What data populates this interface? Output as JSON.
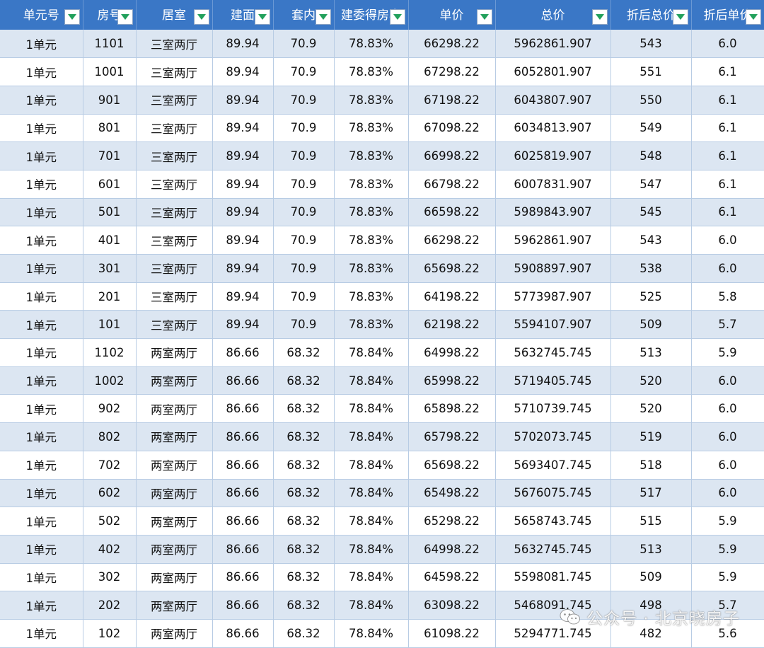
{
  "table": {
    "columns": [
      "单元号",
      "房号",
      "居室",
      "建面",
      "套内",
      "建委得房率",
      "单价",
      "总价",
      "折后总价",
      "折后单价"
    ],
    "rows": [
      [
        "1单元",
        "1101",
        "三室两厅",
        "89.94",
        "70.9",
        "78.83%",
        "66298.22",
        "5962861.907",
        "543",
        "6.0"
      ],
      [
        "1单元",
        "1001",
        "三室两厅",
        "89.94",
        "70.9",
        "78.83%",
        "67298.22",
        "6052801.907",
        "551",
        "6.1"
      ],
      [
        "1单元",
        "901",
        "三室两厅",
        "89.94",
        "70.9",
        "78.83%",
        "67198.22",
        "6043807.907",
        "550",
        "6.1"
      ],
      [
        "1单元",
        "801",
        "三室两厅",
        "89.94",
        "70.9",
        "78.83%",
        "67098.22",
        "6034813.907",
        "549",
        "6.1"
      ],
      [
        "1单元",
        "701",
        "三室两厅",
        "89.94",
        "70.9",
        "78.83%",
        "66998.22",
        "6025819.907",
        "548",
        "6.1"
      ],
      [
        "1单元",
        "601",
        "三室两厅",
        "89.94",
        "70.9",
        "78.83%",
        "66798.22",
        "6007831.907",
        "547",
        "6.1"
      ],
      [
        "1单元",
        "501",
        "三室两厅",
        "89.94",
        "70.9",
        "78.83%",
        "66598.22",
        "5989843.907",
        "545",
        "6.1"
      ],
      [
        "1单元",
        "401",
        "三室两厅",
        "89.94",
        "70.9",
        "78.83%",
        "66298.22",
        "5962861.907",
        "543",
        "6.0"
      ],
      [
        "1单元",
        "301",
        "三室两厅",
        "89.94",
        "70.9",
        "78.83%",
        "65698.22",
        "5908897.907",
        "538",
        "6.0"
      ],
      [
        "1单元",
        "201",
        "三室两厅",
        "89.94",
        "70.9",
        "78.83%",
        "64198.22",
        "5773987.907",
        "525",
        "5.8"
      ],
      [
        "1单元",
        "101",
        "三室两厅",
        "89.94",
        "70.9",
        "78.83%",
        "62198.22",
        "5594107.907",
        "509",
        "5.7"
      ],
      [
        "1单元",
        "1102",
        "两室两厅",
        "86.66",
        "68.32",
        "78.84%",
        "64998.22",
        "5632745.745",
        "513",
        "5.9"
      ],
      [
        "1单元",
        "1002",
        "两室两厅",
        "86.66",
        "68.32",
        "78.84%",
        "65998.22",
        "5719405.745",
        "520",
        "6.0"
      ],
      [
        "1单元",
        "902",
        "两室两厅",
        "86.66",
        "68.32",
        "78.84%",
        "65898.22",
        "5710739.745",
        "520",
        "6.0"
      ],
      [
        "1单元",
        "802",
        "两室两厅",
        "86.66",
        "68.32",
        "78.84%",
        "65798.22",
        "5702073.745",
        "519",
        "6.0"
      ],
      [
        "1单元",
        "702",
        "两室两厅",
        "86.66",
        "68.32",
        "78.84%",
        "65698.22",
        "5693407.745",
        "518",
        "6.0"
      ],
      [
        "1单元",
        "602",
        "两室两厅",
        "86.66",
        "68.32",
        "78.84%",
        "65498.22",
        "5676075.745",
        "517",
        "6.0"
      ],
      [
        "1单元",
        "502",
        "两室两厅",
        "86.66",
        "68.32",
        "78.84%",
        "65298.22",
        "5658743.745",
        "515",
        "5.9"
      ],
      [
        "1单元",
        "402",
        "两室两厅",
        "86.66",
        "68.32",
        "78.84%",
        "64998.22",
        "5632745.745",
        "513",
        "5.9"
      ],
      [
        "1单元",
        "302",
        "两室两厅",
        "86.66",
        "68.32",
        "78.84%",
        "64598.22",
        "5598081.745",
        "509",
        "5.9"
      ],
      [
        "1单元",
        "202",
        "两室两厅",
        "86.66",
        "68.32",
        "78.84%",
        "63098.22",
        "5468091.745",
        "498",
        "5.7"
      ],
      [
        "1单元",
        "102",
        "两室两厅",
        "86.66",
        "68.32",
        "78.84%",
        "61098.22",
        "5294771.745",
        "482",
        "5.6"
      ]
    ]
  },
  "watermark": {
    "text": "公众号 · 北京晓房子",
    "icon": "wechat-icon"
  },
  "colors": {
    "header_bg": "#3a77c6",
    "header_text": "#ffffff",
    "row_alt": "#dce6f2",
    "row_plain": "#ffffff",
    "filter_arrow": "#21a05b",
    "grid_line": "#b8cce4"
  }
}
